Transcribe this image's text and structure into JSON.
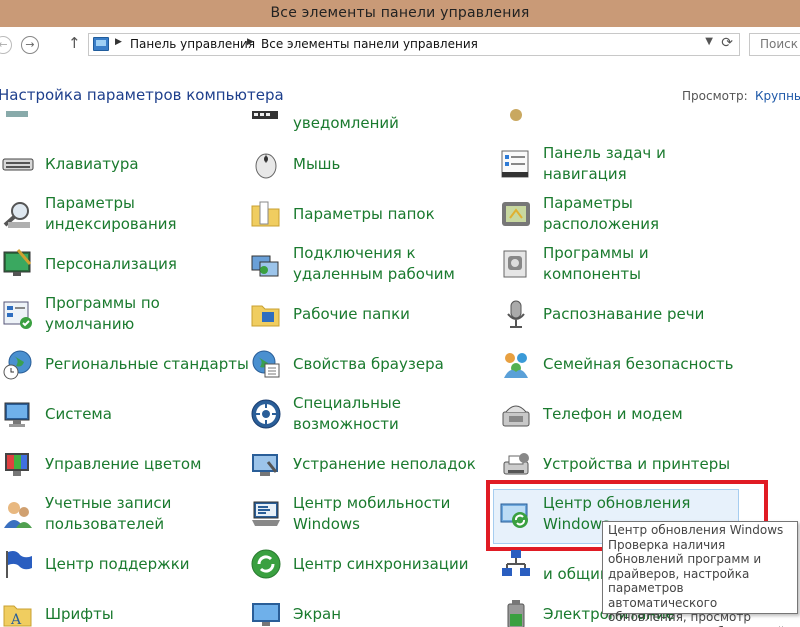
{
  "window": {
    "title": "Все элементы панели управления"
  },
  "address_bar": {
    "crumbs": [
      "Панель управления",
      "Все элементы панели управления"
    ],
    "search_placeholder": "Поиск в"
  },
  "header": {
    "title": "Настройка параметров компьютера",
    "view_label": "Просмотр:",
    "view_value": "Крупные"
  },
  "items": {
    "partial_top": "уведомлений",
    "keyboard": "Клавиатура",
    "mouse": "Мышь",
    "taskbar": "Панель задач и навигация",
    "indexing": "Параметры индексирования",
    "folder_options": "Параметры папок",
    "location": "Параметры расположения",
    "personalization": "Персонализация",
    "remote_desktop": "Подключения к удаленным рабочим",
    "programs_features": "Программы и компоненты",
    "default_programs": "Программы по умолчанию",
    "work_folders": "Рабочие папки",
    "speech": "Распознавание речи",
    "region": "Региональные стандарты",
    "internet_options": "Свойства браузера",
    "family_safety": "Семейная безопасность",
    "system": "Система",
    "ease_of_access": "Специальные возможности",
    "phone_modem": "Телефон и модем",
    "color_management": "Управление цветом",
    "troubleshooting": "Устранение неполадок",
    "devices_printers": "Устройства и принтеры",
    "user_accounts": "Учетные записи пользователей",
    "mobility_center": "Центр мобильности Windows",
    "windows_update": "Центр обновления Windows",
    "action_center": "Центр поддержки",
    "sync_center": "Центр синхронизации",
    "network_sharing": "и общим",
    "fonts": "Шрифты",
    "display": "Экран",
    "power": "Электропитание"
  },
  "tooltip": {
    "title": "Центр обновления Windows",
    "description": "Проверка наличия обновлений программ и драйверов, настройка параметров автоматического обновления, просмотр установленных обновлений."
  },
  "colors": {
    "link_green": "#1a7a2e",
    "heading_blue": "#1e3f8c",
    "highlight_red": "#e01b24",
    "titlebar": "#c99a77"
  }
}
